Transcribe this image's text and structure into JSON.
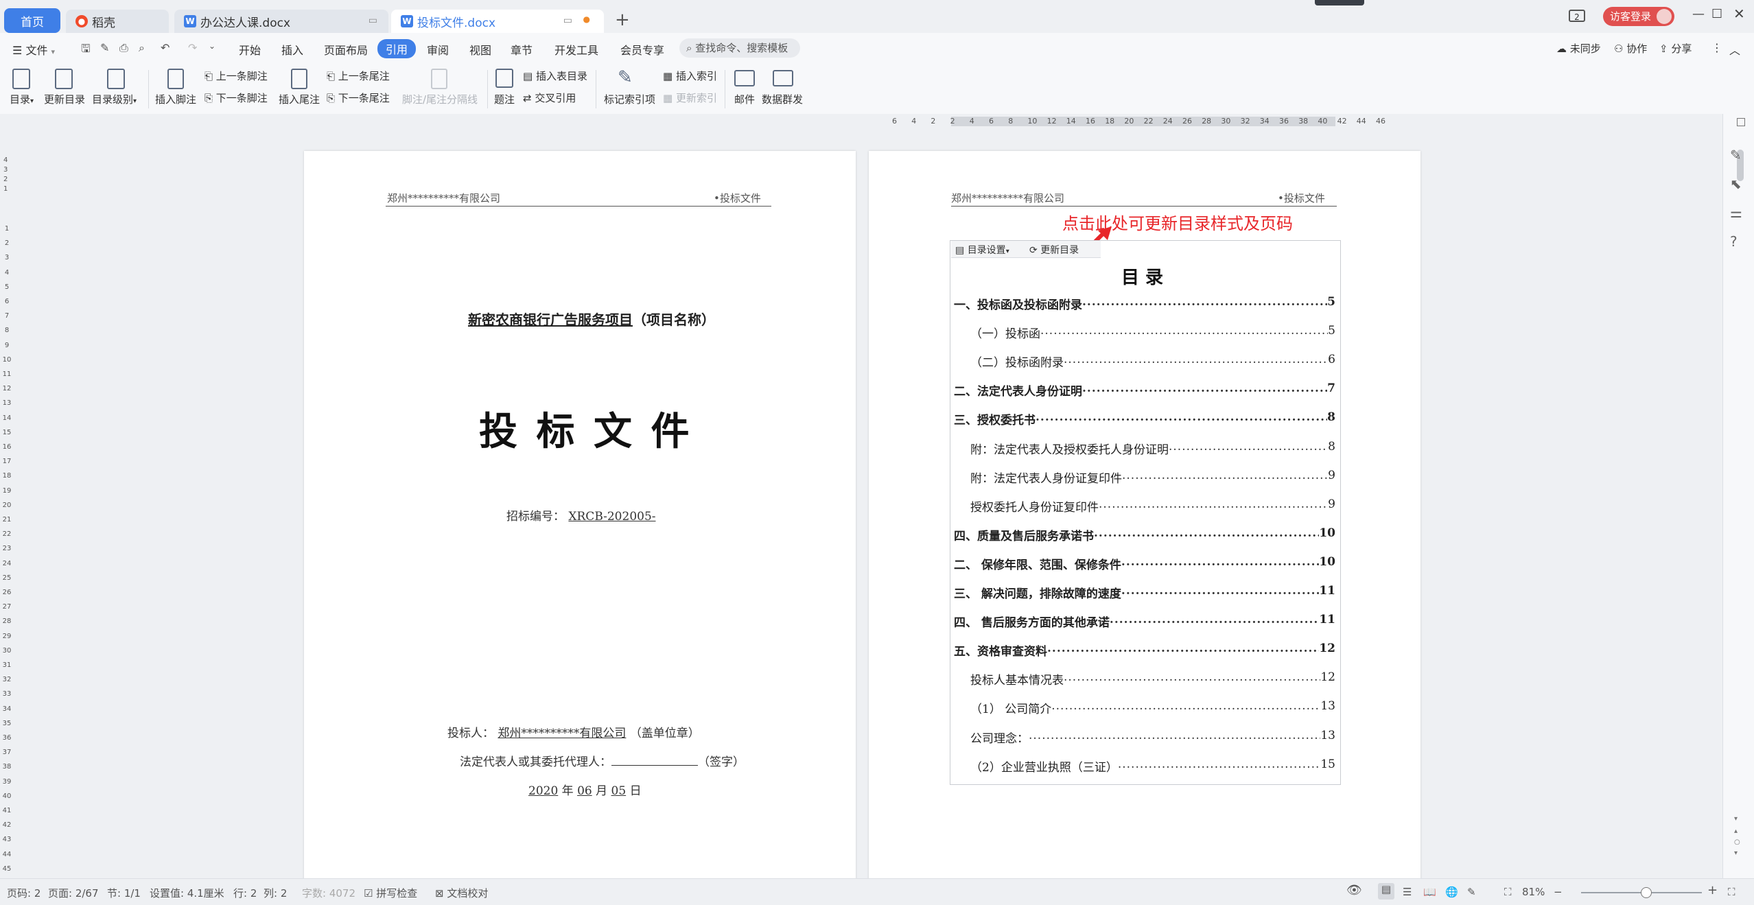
{
  "titlebar": {
    "tabs": [
      {
        "label": "首页",
        "icon": "home"
      },
      {
        "label": "稻壳",
        "icon": "daoke-icon"
      },
      {
        "label": "办公达人课.docx",
        "icon": "word-doc-icon"
      },
      {
        "label": "投标文件.docx",
        "icon": "word-doc-icon"
      }
    ],
    "tab_count_badge": "2",
    "login_label": "访客登录"
  },
  "menubar": {
    "file_label": "文件",
    "items": [
      "开始",
      "插入",
      "页面布局",
      "引用",
      "审阅",
      "视图",
      "章节",
      "开发工具",
      "会员专享"
    ],
    "active_item": "引用",
    "search_placeholder": "查找命令、搜索模板",
    "right_items": [
      "未同步",
      "协作",
      "分享"
    ]
  },
  "ribbon": {
    "toc": "目录",
    "update_toc": "更新目录",
    "toc_level": "目录级别",
    "insert_footnote": "插入脚注",
    "prev_footnote": "上一条脚注",
    "next_footnote": "下一条脚注",
    "insert_endnote": "插入尾注",
    "prev_endnote": "上一条尾注",
    "next_endnote": "下一条尾注",
    "footnote_separator": "脚注/尾注分隔线",
    "caption": "题注",
    "insert_table_of_figures": "插入表目录",
    "cross_reference": "交叉引用",
    "mark_index_entry": "标记索引项",
    "insert_index": "插入索引",
    "update_index": "更新索引",
    "mail": "邮件",
    "data_mass_send": "数据群发"
  },
  "ruler": {
    "h_ticks": [
      "6",
      "4",
      "2",
      "2",
      "4",
      "6",
      "8",
      "10",
      "12",
      "14",
      "16",
      "18",
      "20",
      "22",
      "24",
      "26",
      "28",
      "30",
      "32",
      "34",
      "36",
      "38",
      "40",
      "42",
      "44",
      "46"
    ],
    "v_ticks_top": [
      "4",
      "3",
      "2",
      "1"
    ],
    "v_ticks": [
      "1",
      "2",
      "3",
      "4",
      "5",
      "6",
      "7",
      "8",
      "9",
      "10",
      "11",
      "12",
      "13",
      "14",
      "15",
      "16",
      "17",
      "18",
      "19",
      "20",
      "21",
      "22",
      "23",
      "24",
      "25",
      "26",
      "27",
      "28",
      "29",
      "30",
      "31",
      "32",
      "33",
      "34",
      "35",
      "36",
      "37",
      "38",
      "39",
      "40",
      "41",
      "42",
      "43",
      "44",
      "45"
    ]
  },
  "page1": {
    "header_left": "郑州**********有限公司",
    "header_right": "•投标文件",
    "project_name": "新密农商银行广告服务项目",
    "project_suffix": "（项目名称）",
    "doc_title": "投 标 文 件",
    "bid_no_label": "招标编号：",
    "bid_no_value": "XRCB-202005-",
    "bidder_label": "投标人：",
    "bidder_value": "郑州**********有限公司",
    "bidder_suffix": "（盖单位章）",
    "rep_label": "法定代表人或其委托代理人：",
    "rep_suffix": "（签字）",
    "date_year": "2020",
    "date_year_unit": "年",
    "date_month": "06",
    "date_month_unit": "月",
    "date_day": "05",
    "date_day_unit": "日"
  },
  "page2": {
    "header_left": "郑州**********有限公司",
    "header_right": "•投标文件",
    "annotation": "点击此处可更新目录样式及页码",
    "toc_settings_btn": "目录设置",
    "toc_update_btn": "更新目录",
    "toc_title": "目 录",
    "toc": [
      {
        "text": "一、投标函及投标函附录",
        "page": "5",
        "bold": true,
        "indent": 0
      },
      {
        "text": "（一）投标函",
        "page": "5",
        "bold": false,
        "indent": 1
      },
      {
        "text": "（二）投标函附录",
        "page": "6",
        "bold": false,
        "indent": 1
      },
      {
        "text": "二、法定代表人身份证明",
        "page": "7",
        "bold": true,
        "indent": 0
      },
      {
        "text": "三、授权委托书",
        "page": "8",
        "bold": true,
        "indent": 0
      },
      {
        "text": "附：法定代表人及授权委托人身份证明",
        "page": "8",
        "bold": false,
        "indent": 1
      },
      {
        "text": "附：法定代表人身份证复印件",
        "page": "9",
        "bold": false,
        "indent": 1
      },
      {
        "text": "授权委托人身份证复印件",
        "page": "9",
        "bold": false,
        "indent": 1
      },
      {
        "text": "四、质量及售后服务承诺书",
        "page": "10",
        "bold": true,
        "indent": 0
      },
      {
        "text": "二、 保修年限、范围、保修条件",
        "page": "10",
        "bold": true,
        "indent": 0
      },
      {
        "text": "三、 解决问题，排除故障的速度",
        "page": "11",
        "bold": true,
        "indent": 0
      },
      {
        "text": "四、 售后服务方面的其他承诺",
        "page": "11",
        "bold": true,
        "indent": 0
      },
      {
        "text": "五、资格审查资料",
        "page": "12",
        "bold": true,
        "indent": 0
      },
      {
        "text": "投标人基本情况表",
        "page": "12",
        "bold": false,
        "indent": 1
      },
      {
        "text": "（1） 公司简介",
        "page": "13",
        "bold": false,
        "indent": 1
      },
      {
        "text": "公司理念：",
        "page": "13",
        "bold": false,
        "indent": 1
      },
      {
        "text": "（2）企业营业执照（三证）",
        "page": "15",
        "bold": false,
        "indent": 1
      }
    ]
  },
  "statusbar": {
    "page_num": "页码: 2",
    "pages": "页面: 2/67",
    "section": "节: 1/1",
    "setting": "设置值: 4.1厘米",
    "row": "行: 2",
    "col": "列: 2",
    "word_count": "字数: 4072",
    "spell_check": "拼写检查",
    "proofread": "文档校对",
    "zoom": "81%"
  },
  "colors": {
    "accent": "#3f7fe7",
    "annotation": "#e8262a",
    "login_bg": "#e0504f"
  }
}
